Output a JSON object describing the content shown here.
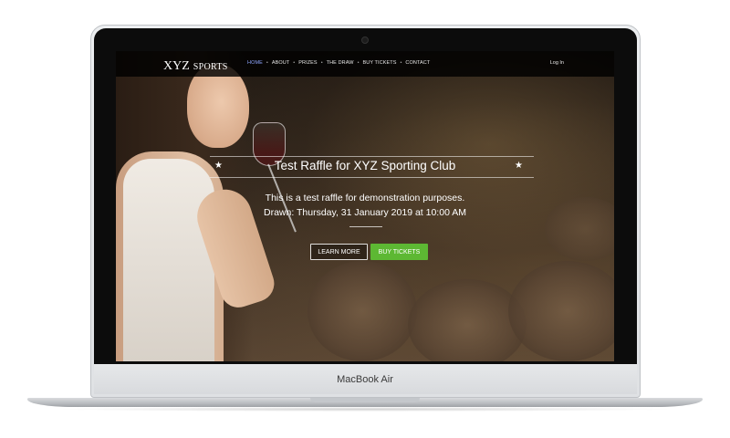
{
  "device": {
    "brand_label": "MacBook Air"
  },
  "site": {
    "logo": {
      "main": "XYZ",
      "sub": "SPORTS"
    },
    "nav": {
      "items": [
        {
          "label": "HOME",
          "active": true
        },
        {
          "label": "ABOUT",
          "active": false
        },
        {
          "label": "PRIZES",
          "active": false
        },
        {
          "label": "THE DRAW",
          "active": false
        },
        {
          "label": "BUY TICKETS",
          "active": false
        },
        {
          "label": "CONTACT",
          "active": false
        }
      ],
      "login_label": "Log In"
    },
    "hero": {
      "title": "Test Raffle for XYZ Sporting Club",
      "star_glyph": "★",
      "description": "This is a test raffle for demonstration purposes.",
      "drawn": "Drawn: Thursday, 31 January 2019 at 10:00 AM",
      "learn_more_label": "LEARN MORE",
      "buy_tickets_label": "BUY TICKETS"
    }
  },
  "colors": {
    "nav_active": "#8fa6ff",
    "buy_button": "#5db833",
    "nav_background": "#000000"
  }
}
